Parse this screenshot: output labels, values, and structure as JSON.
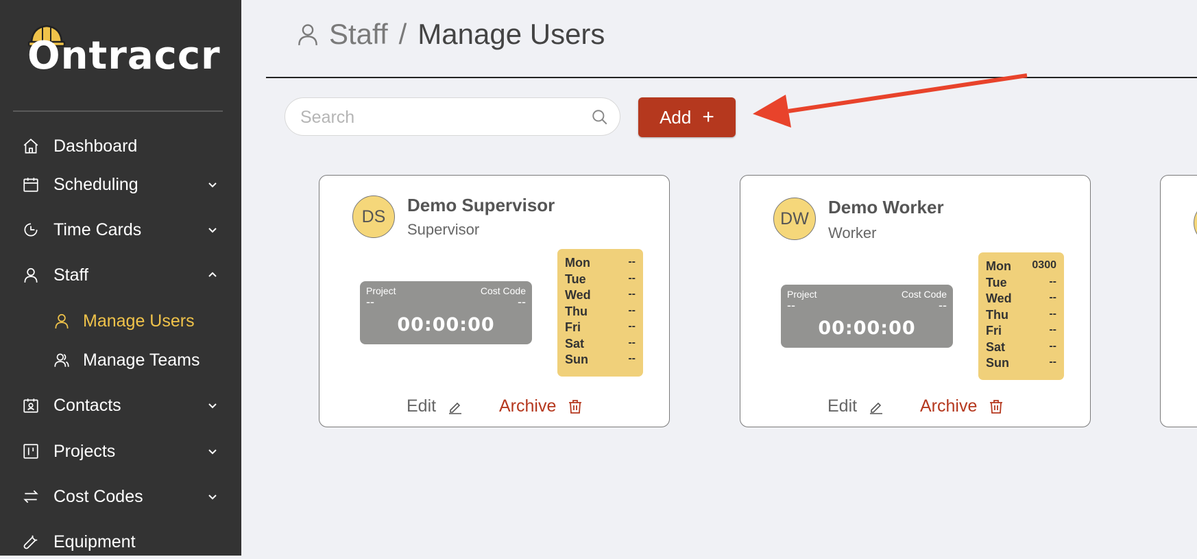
{
  "app": {
    "brand": "Ontraccr"
  },
  "sidebar": {
    "items": [
      {
        "label": "Dashboard",
        "icon": "home-icon"
      },
      {
        "label": "Scheduling",
        "icon": "calendar-icon"
      },
      {
        "label": "Time Cards",
        "icon": "clock-icon"
      },
      {
        "label": "Staff",
        "icon": "user-icon"
      },
      {
        "label": "Manage Users",
        "icon": "user-icon"
      },
      {
        "label": "Manage Teams",
        "icon": "team-icon"
      },
      {
        "label": "Contacts",
        "icon": "contact-card-icon"
      },
      {
        "label": "Projects",
        "icon": "project-board-icon"
      },
      {
        "label": "Cost Codes",
        "icon": "swap-icon"
      },
      {
        "label": "Equipment",
        "icon": "wrench-icon"
      }
    ]
  },
  "breadcrumb": {
    "parent": "Staff",
    "separator": "/",
    "current": "Manage Users"
  },
  "toolbar": {
    "search_placeholder": "Search",
    "add_label": "Add",
    "add_icon": "+"
  },
  "colors": {
    "accent": "#b5381e",
    "sidebar_bg": "#333333",
    "active": "#f0c34a",
    "schedule_bg": "#f0d07a",
    "avatar_bg": "#f5d77a"
  },
  "cards": [
    {
      "initials": "DS",
      "name": "Demo Supervisor",
      "role": "Supervisor",
      "project_label": "Project",
      "project_value": "--",
      "cost_code_label": "Cost Code",
      "cost_code_value": "--",
      "timer": "00:00:00",
      "schedule": [
        {
          "day": "Mon",
          "value": "--"
        },
        {
          "day": "Tue",
          "value": "--"
        },
        {
          "day": "Wed",
          "value": "--"
        },
        {
          "day": "Thu",
          "value": "--"
        },
        {
          "day": "Fri",
          "value": "--"
        },
        {
          "day": "Sat",
          "value": "--"
        },
        {
          "day": "Sun",
          "value": "--"
        }
      ],
      "edit_label": "Edit",
      "archive_label": "Archive"
    },
    {
      "initials": "DW",
      "name": "Demo Worker",
      "role": "Worker",
      "project_label": "Project",
      "project_value": "--",
      "cost_code_label": "Cost Code",
      "cost_code_value": "--",
      "timer": "00:00:00",
      "schedule": [
        {
          "day": "Mon",
          "value": "0300"
        },
        {
          "day": "Tue",
          "value": "--"
        },
        {
          "day": "Wed",
          "value": "--"
        },
        {
          "day": "Thu",
          "value": "--"
        },
        {
          "day": "Fri",
          "value": "--"
        },
        {
          "day": "Sat",
          "value": "--"
        },
        {
          "day": "Sun",
          "value": "--"
        }
      ],
      "edit_label": "Edit",
      "archive_label": "Archive"
    }
  ]
}
